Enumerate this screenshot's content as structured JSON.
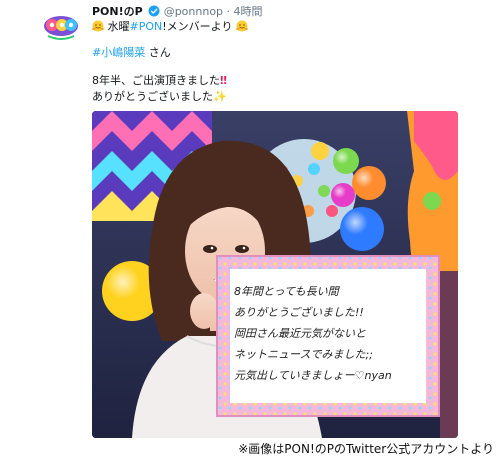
{
  "tweet": {
    "display_name": "PON!のP",
    "handle": "@ponnnop",
    "separator": "·",
    "time": "4時間",
    "line1": {
      "prefix": "水曜",
      "hashtag": "#PON",
      "suffix": "!メンバーより"
    },
    "mention": {
      "hashtag": "#小嶋陽菜",
      "suffix": " さん"
    },
    "line3": {
      "text": "8年半、ご出演頂きました",
      "mark": "‼"
    },
    "line4": {
      "text": "ありがとうございました",
      "mark": "✨"
    }
  },
  "whiteboard": {
    "lines": [
      "8年間とっても長い間",
      "ありがとうございました!!",
      "岡田さん最近元気がないと",
      "ネットニュースでみました;;",
      "元気出していきましょー♡nyan"
    ]
  },
  "caption": "※画像はPON!のPのTwitter公式アカウントより",
  "colors": {
    "link": "#1da1f2",
    "muted": "#657786",
    "verified": "#1da1f2"
  },
  "icons": [
    "verified-badge-icon",
    "hug-emoji-icon",
    "sparkle-icon"
  ]
}
